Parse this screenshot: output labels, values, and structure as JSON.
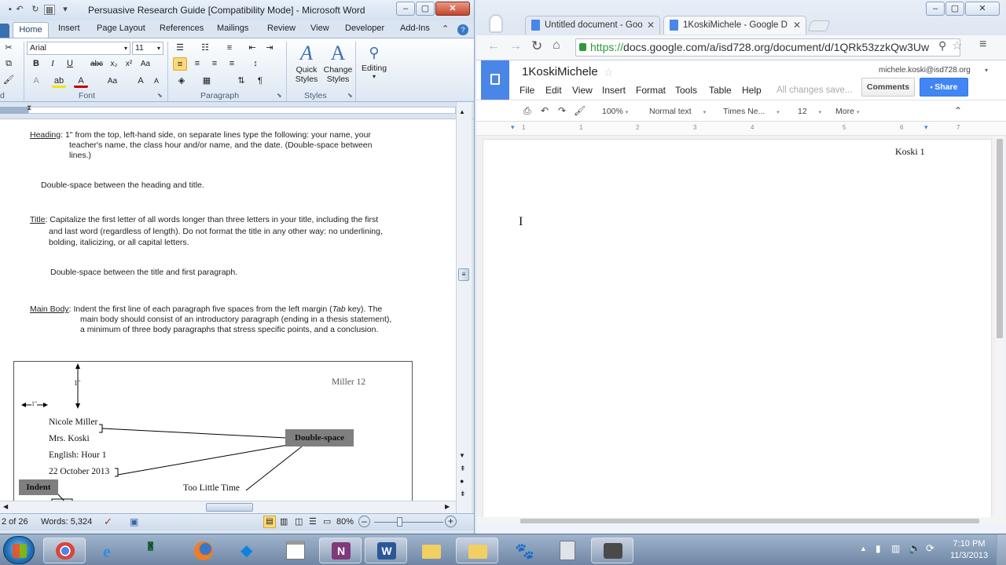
{
  "word": {
    "title": "Persuasive Research Guide [Compatibility Mode] - Microsoft Word",
    "tabs": [
      "Home",
      "Insert",
      "Page Layout",
      "References",
      "Mailings",
      "Review",
      "View",
      "Developer",
      "Add-Ins"
    ],
    "font_name": "Arial",
    "font_size": "11",
    "groups": {
      "font": "Font",
      "paragraph": "Paragraph",
      "styles": "Styles"
    },
    "quick_styles": "Quick Styles",
    "change_styles": "Change Styles",
    "editing": "Editing",
    "doc": {
      "heading_label": "Heading",
      "heading_text": ": 1\" from the top, left-hand side, on separate lines type the following: your name, your",
      "heading_line2": "teacher's name, the class hour and/or name, and the date. (Double-space between",
      "heading_line3": "lines.)",
      "ds1": "Double-space between the heading and title.",
      "title_label": "Title",
      "title_text": ": Capitalize the first letter of all words longer than three letters in your title, including the first",
      "title_line2": "and last word (regardless of length). Do not format the title in any other way: no underlining,",
      "title_line3": "bolding, italicizing, or all capital letters.",
      "ds2": "Double-space between the title and first paragraph.",
      "main_label": "Main Body",
      "main_text_a": ": Indent the first line of each paragraph five spaces from the left margin (",
      "main_text_tab": "Tab",
      "main_text_b": " key). The",
      "main_line2": "main body should consist of an introductory paragraph (ending in a thesis statement),",
      "main_line3": "a minimum of three body paragraphs that stress specific points, and a conclusion.",
      "fig": {
        "header": "Miller 12",
        "one_inch": "1\"",
        "one_inch_h": "1\"",
        "name": "Nicole Miller",
        "teacher": "Mrs. Koski",
        "class": "English: Hour 1",
        "date": "22 October 2013",
        "callout_ds": "Double-space",
        "callout_indent": "Indent",
        "doc_title": "Too Little Time"
      }
    },
    "status": {
      "page": "2 of 26",
      "words": "Words: 5,324",
      "zoom": "80%"
    }
  },
  "chrome": {
    "tabs": [
      {
        "title": "Untitled document - Goo"
      },
      {
        "title": "1KoskiMichele - Google D"
      }
    ],
    "url_https": "https://",
    "url_rest": "docs.google.com/a/isd728.org/document/d/1QRk53zzkQw3Uw",
    "doc_title": "1KoskiMichele",
    "user": "michele.koski@isd728.org",
    "menus": [
      "File",
      "Edit",
      "View",
      "Insert",
      "Format",
      "Tools",
      "Table",
      "Help"
    ],
    "save_status": "All changes save...",
    "comments": "Comments",
    "share": "Share",
    "toolbar": {
      "zoom": "100%",
      "style": "Normal text",
      "font": "Times Ne...",
      "size": "12",
      "more": "More"
    },
    "ruler": [
      "1",
      "1",
      "2",
      "3",
      "4",
      "5",
      "6",
      "7"
    ],
    "page_header": "Koski 1"
  },
  "taskbar": {
    "time": "7:10 PM",
    "date": "11/3/2013"
  },
  "colors": {
    "word_blue": "#dbe5f1",
    "gdocs_blue": "#4a86e8",
    "share_blue": "#4285f4"
  }
}
